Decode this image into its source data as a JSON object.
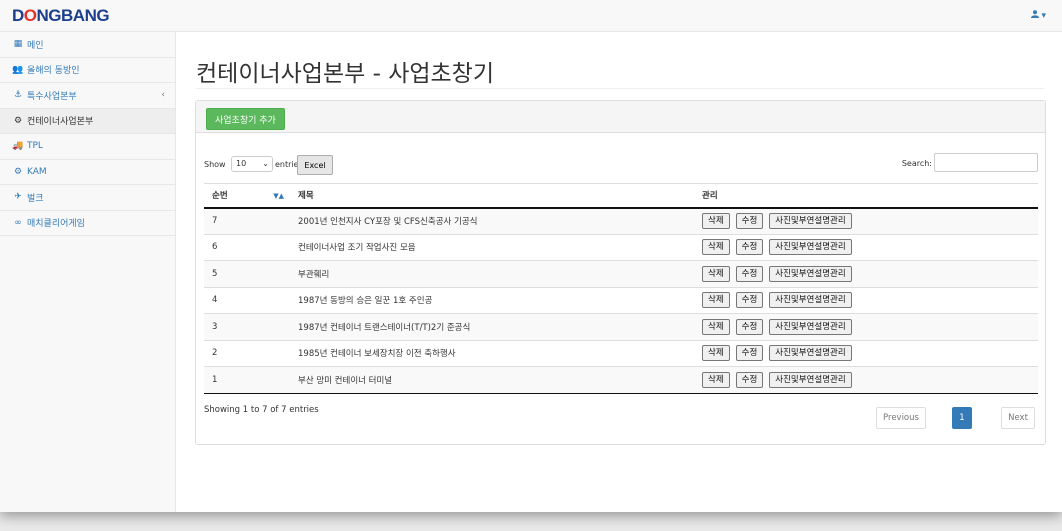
{
  "header": {
    "logo_pre": "D",
    "logo_o": "O",
    "logo_post": "NGBANG",
    "user_icon": "user-icon",
    "user_caret": "▾"
  },
  "sidebar": {
    "items": [
      {
        "icon": "▦",
        "label": "메인"
      },
      {
        "icon": "👥",
        "label": "올해의 동방인"
      },
      {
        "icon": "⚓",
        "label": "특수사업본부",
        "caret": "‹"
      },
      {
        "icon": "⚙",
        "label": "컨테이너사업본부",
        "active": true
      },
      {
        "icon": "🚚",
        "label": "TPL"
      },
      {
        "icon": "⚙",
        "label": "KAM"
      },
      {
        "icon": "✈",
        "label": "벌크"
      },
      {
        "icon": "∞",
        "label": "매치클리어게임"
      }
    ]
  },
  "page": {
    "title": "컨테이너사업본부 - 사업초창기",
    "add_button": "사업초창기 추가"
  },
  "controls": {
    "show_label": "Show",
    "length_value": "10",
    "entries_label": "entries",
    "excel_button": "Excel",
    "search_label": "Search:",
    "search_value": ""
  },
  "table": {
    "headers": [
      "순번",
      "제목",
      "관리"
    ],
    "actions": [
      "삭제",
      "수정",
      "사진및부연설명관리"
    ],
    "rows": [
      {
        "no": "7",
        "title": "2001년 인천지사 CY포장 및 CFS신축공사 기공식"
      },
      {
        "no": "6",
        "title": "컨테이너사업 조기 작업사진 모음"
      },
      {
        "no": "5",
        "title": "부관훼리"
      },
      {
        "no": "4",
        "title": "1987년 동방의 승은 일꾼 1호 주인공"
      },
      {
        "no": "3",
        "title": "1987년 컨테이너 트랜스테이너(T/T)2기 준공식"
      },
      {
        "no": "2",
        "title": "1985년 컨테이너 보세장치장 이전 축하행사"
      },
      {
        "no": "1",
        "title": "부산 망미 컨테이너 터미널"
      }
    ]
  },
  "footer": {
    "info": "Showing 1 to 7 of 7 entries",
    "previous": "Previous",
    "page": "1",
    "next": "Next"
  },
  "colors": {
    "logo_blue": "#1c3f8c",
    "logo_red": "#e4322b",
    "link_blue": "#337ab7",
    "add_green": "#5cb85c"
  }
}
